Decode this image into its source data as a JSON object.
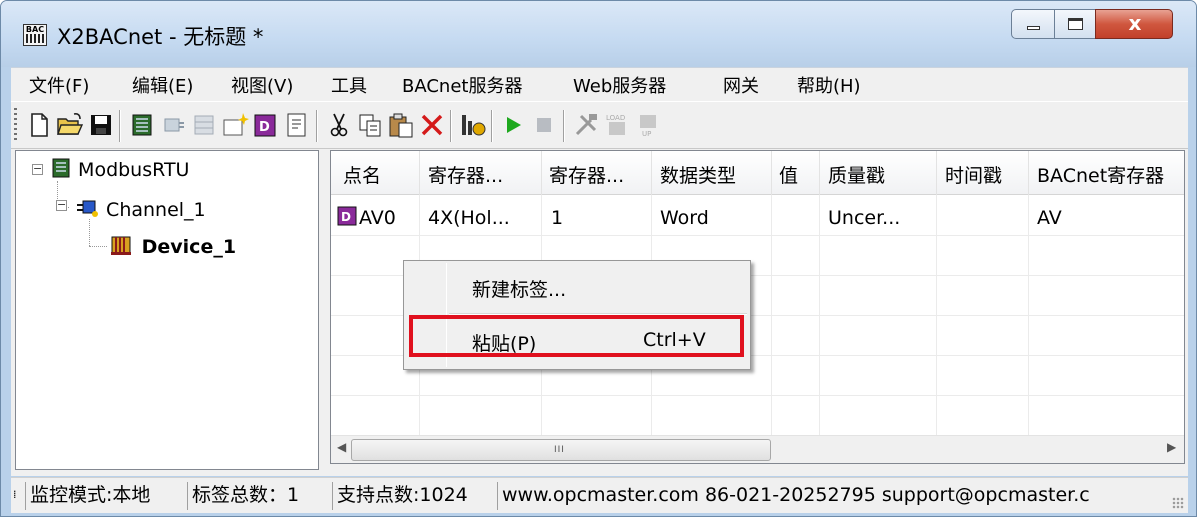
{
  "window": {
    "title": "X2BACnet - 无标题 *",
    "icon_text": "BAC",
    "close_glyph": "x"
  },
  "menubar": {
    "items": [
      "文件(F)",
      "编辑(E)",
      "视图(V)",
      "工具",
      "BACnet服务器",
      "Web服务器",
      "网关",
      "帮助(H)"
    ]
  },
  "toolbar": {
    "buttons": [
      "new-file-icon",
      "open-folder-icon",
      "save-icon",
      "add-device-icon",
      "add-channel-icon",
      "add-group-icon",
      "add-tag-icon",
      "add-bacnet-icon",
      "properties-icon",
      "cut-icon",
      "copy-icon",
      "paste-icon",
      "delete-icon",
      "tag-wizard-icon",
      "run-icon",
      "stop-icon",
      "tools-icon",
      "load-icon",
      "upload-icon"
    ]
  },
  "tree": {
    "root": "ModbusRTU",
    "channel": "Channel_1",
    "device": "Device_1"
  },
  "table": {
    "columns": [
      "点名",
      "寄存器...",
      "寄存器...",
      "数据类型",
      "值",
      "质量戳",
      "时间戳",
      "BACnet寄存器"
    ],
    "rows": [
      [
        "AV0",
        "4X(Hol...",
        "1",
        "Word",
        "",
        "Uncer...",
        "",
        "AV"
      ]
    ],
    "scroll_grip": "III"
  },
  "context_menu": {
    "items": [
      {
        "label": "新建标签...",
        "shortcut": ""
      },
      {
        "label": "粘贴(P)",
        "shortcut": "Ctrl+V"
      }
    ]
  },
  "statusbar": {
    "panels": [
      "监控模式:本地",
      "标签总数：1",
      "支持点数:1024",
      "www.opcmaster.com 86-021-20252795 support@opcmaster.c"
    ]
  },
  "colors": {
    "highlight_box": "#e0101e",
    "close_button": "#c2402a"
  }
}
